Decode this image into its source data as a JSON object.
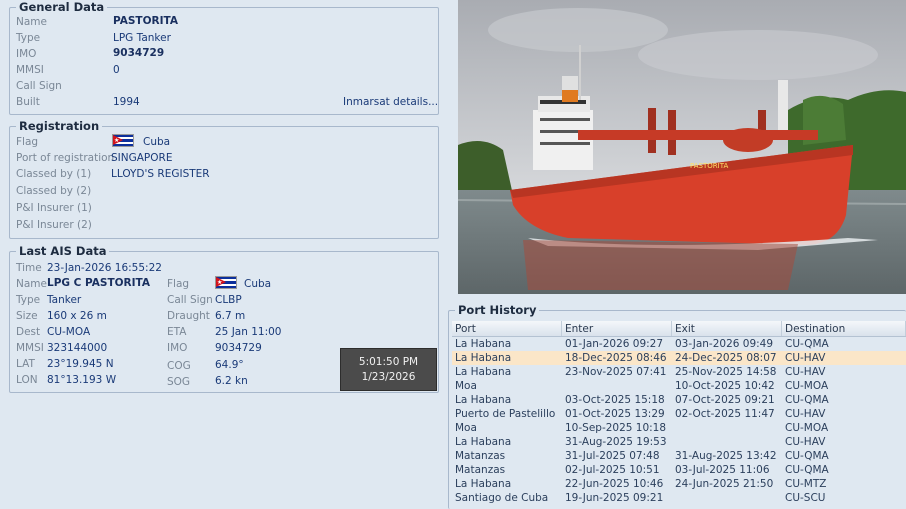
{
  "general": {
    "title": "General Data",
    "name_label": "Name",
    "name": "PASTORITA",
    "type_label": "Type",
    "type": "LPG Tanker",
    "imo_label": "IMO",
    "imo": "9034729",
    "mmsi_label": "MMSI",
    "mmsi": "0",
    "callsign_label": "Call Sign",
    "callsign": "",
    "built_label": "Built",
    "built": "1994",
    "inmarsat_link": "Inmarsat details..."
  },
  "registration": {
    "title": "Registration",
    "flag_label": "Flag",
    "flag": "Cuba",
    "port_label": "Port of registration",
    "port": "SINGAPORE",
    "class1_label": "Classed by (1)",
    "class1": "LLOYD'S REGISTER",
    "class2_label": "Classed by (2)",
    "class2": "",
    "pi1_label": "P&I Insurer (1)",
    "pi1": "",
    "pi2_label": "P&I Insurer (2)",
    "pi2": ""
  },
  "ais": {
    "title": "Last AIS Data",
    "time_label": "Time",
    "time": "23-Jan-2026 16:55:22",
    "name_label": "Name",
    "name": "LPG C PASTORITA",
    "type_label": "Type",
    "type": "Tanker",
    "size_label": "Size",
    "size": "160 x 26 m",
    "dest_label": "Dest",
    "dest": "CU-MOA",
    "mmsi_label": "MMSI",
    "mmsi": "323144000",
    "lat_label": "LAT",
    "lat": "23°19.945 N",
    "lon_label": "LON",
    "lon": "81°13.193 W",
    "flag_label": "Flag",
    "flag": "Cuba",
    "callsign_label": "Call Sign",
    "callsign": "CLBP",
    "draught_label": "Draught",
    "draught": "6.7 m",
    "eta_label": "ETA",
    "eta": "25 Jan 11:00",
    "imo_label": "IMO",
    "imo": "9034729",
    "cog_label": "COG",
    "cog": "64.9°",
    "sog_label": "SOG",
    "sog": "6.2 kn"
  },
  "clock": {
    "time": "5:01:50 PM",
    "date": "1/23/2026"
  },
  "port_history": {
    "title": "Port History",
    "headers": [
      "Port",
      "Enter",
      "Exit",
      "Destination"
    ],
    "rows": [
      [
        "La Habana",
        "01-Jan-2026 09:27",
        "03-Jan-2026 09:49",
        "CU-QMA"
      ],
      [
        "La Habana",
        "18-Dec-2025 08:46",
        "24-Dec-2025 08:07",
        "CU-HAV"
      ],
      [
        "La Habana",
        "23-Nov-2025 07:41",
        "25-Nov-2025 14:58",
        "CU-HAV"
      ],
      [
        "Moa",
        "",
        "10-Oct-2025 10:42",
        "CU-MOA"
      ],
      [
        "La Habana",
        "03-Oct-2025 15:18",
        "07-Oct-2025 09:21",
        "CU-QMA"
      ],
      [
        "Puerto de Pastelillo",
        "01-Oct-2025 13:29",
        "02-Oct-2025 11:47",
        "CU-HAV"
      ],
      [
        "Moa",
        "10-Sep-2025 10:18",
        "",
        "CU-MOA"
      ],
      [
        "La Habana",
        "31-Aug-2025 19:53",
        "",
        "CU-HAV"
      ],
      [
        "Matanzas",
        "31-Jul-2025 07:48",
        "31-Aug-2025 13:42",
        "CU-QMA"
      ],
      [
        "Matanzas",
        "02-Jul-2025 10:51",
        "03-Jul-2025 11:06",
        "CU-QMA"
      ],
      [
        "La Habana",
        "22-Jun-2025 10:46",
        "24-Jun-2025 21:50",
        "CU-MTZ"
      ],
      [
        "Santiago de Cuba",
        "19-Jun-2025 09:21",
        "",
        "CU-SCU"
      ]
    ],
    "selected_row": 1
  },
  "photo": {
    "hull_name": "PASTORITA"
  }
}
